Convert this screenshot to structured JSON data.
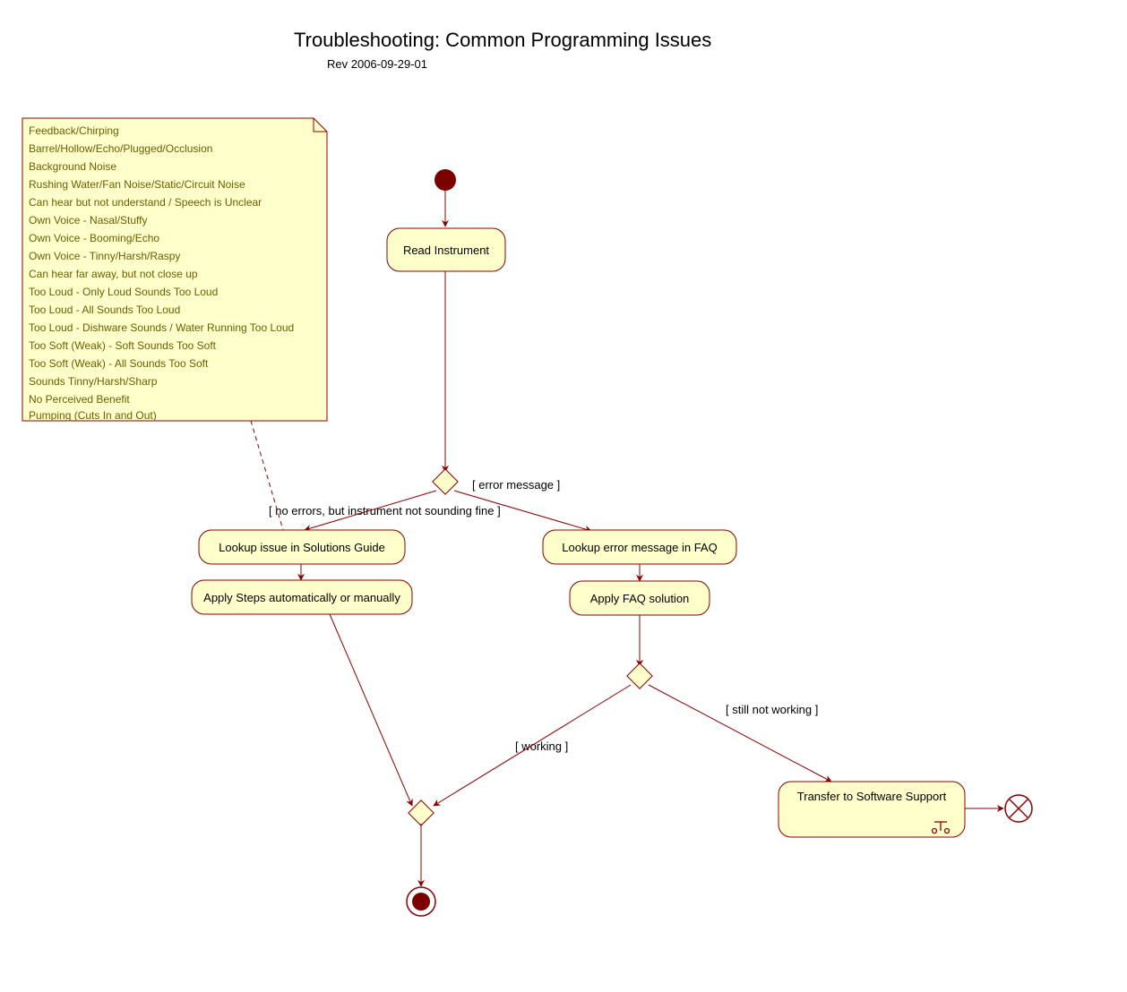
{
  "title": "Troubleshooting: Common Programming Issues",
  "revision": "Rev 2006-09-29-01",
  "note": {
    "lines": [
      "Feedback/Chirping",
      "Barrel/Hollow/Echo/Plugged/Occlusion",
      "Background Noise",
      "Rushing Water/Fan Noise/Static/Circuit Noise",
      "Can hear but not understand / Speech is Unclear",
      "Own Voice - Nasal/Stuffy",
      "Own Voice - Booming/Echo",
      "Own Voice - Tinny/Harsh/Raspy",
      "Can hear far away, but not close up",
      "Too Loud - Only Loud Sounds Too Loud",
      "Too Loud - All Sounds Too Loud",
      "Too Loud - Dishware Sounds / Water Running Too Loud",
      "Too Soft (Weak) - Soft Sounds Too Soft",
      "Too Soft (Weak) - All Sounds Too Soft",
      "Sounds Tinny/Harsh/Sharp",
      "No Perceived Benefit",
      "Pumping (Cuts In and Out)"
    ]
  },
  "nodes": {
    "read": "Read Instrument",
    "lookupGuide": "Lookup issue in Solutions Guide",
    "applySteps": "Apply Steps automatically or manually",
    "lookupFAQ": "Lookup error message in FAQ",
    "applyFAQ": "Apply FAQ solution",
    "transfer": "Transfer to Software Support"
  },
  "guards": {
    "noErrors": "[ no errors, but instrument not sounding fine ]",
    "errorMsg": "[ error message ]",
    "working": "[ working ]",
    "stillNot": "[ still not working ]"
  }
}
